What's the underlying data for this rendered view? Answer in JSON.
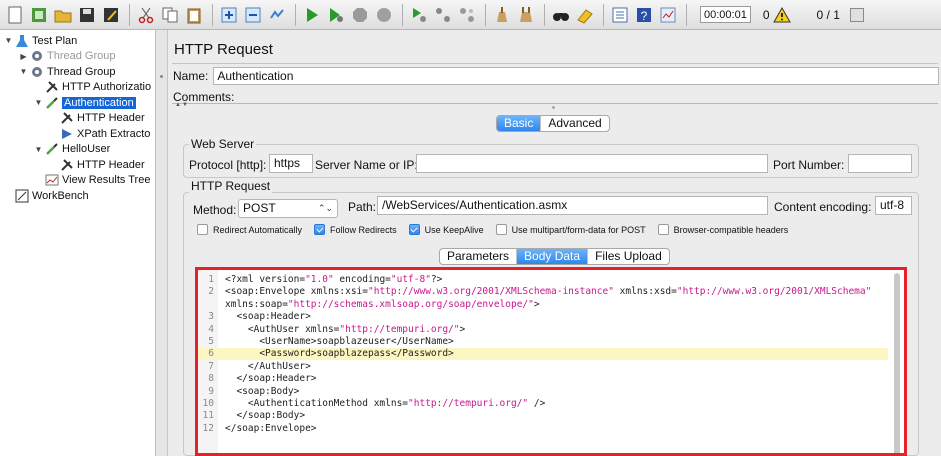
{
  "toolbar": {
    "icons": [
      "new-icon",
      "templates-icon",
      "open-icon",
      "save-icon",
      "save-as-icon",
      "cut-icon",
      "copy-icon",
      "paste-icon",
      "expand-icon",
      "collapse-icon",
      "toggle-icon",
      "start-icon",
      "start-no-timers-icon",
      "stop-icon",
      "shutdown-icon",
      "remote-start-icon",
      "remote-stop-icon",
      "remote-exit-icon",
      "clear-icon",
      "clear-all-icon",
      "search-icon",
      "reset-search-icon",
      "function-helper-icon",
      "help-icon",
      "log-viewer-icon"
    ],
    "timer": "00:00:01",
    "warning_count": "0",
    "threads": "0 / 1"
  },
  "tree": [
    {
      "label": "Test Plan",
      "level": 0,
      "expander": "down",
      "icon": "test-plan-icon",
      "selected": false,
      "disabled": false
    },
    {
      "label": "Thread Group",
      "level": 1,
      "expander": "right",
      "icon": "gear-icon",
      "selected": false,
      "disabled": true
    },
    {
      "label": "Thread Group",
      "level": 1,
      "expander": "down",
      "icon": "gear-icon",
      "selected": false,
      "disabled": false
    },
    {
      "label": "HTTP Authorizatio",
      "level": 2,
      "expander": "",
      "icon": "wrench-icon",
      "selected": false,
      "disabled": false
    },
    {
      "label": "Authentication",
      "level": 2,
      "expander": "down",
      "icon": "pipette-icon",
      "selected": true,
      "disabled": false
    },
    {
      "label": "HTTP Header",
      "level": 3,
      "expander": "",
      "icon": "wrench-icon",
      "selected": false,
      "disabled": false
    },
    {
      "label": "XPath Extracto",
      "level": 3,
      "expander": "",
      "icon": "extractor-icon",
      "selected": false,
      "disabled": false
    },
    {
      "label": "HelloUser",
      "level": 2,
      "expander": "down",
      "icon": "pipette-icon",
      "selected": false,
      "disabled": false
    },
    {
      "label": "HTTP Header",
      "level": 3,
      "expander": "",
      "icon": "wrench-icon",
      "selected": false,
      "disabled": false
    },
    {
      "label": "View Results Tree",
      "level": 2,
      "expander": "",
      "icon": "chart-icon",
      "selected": false,
      "disabled": false
    },
    {
      "label": "WorkBench",
      "level": 0,
      "expander": "",
      "icon": "workbench-icon",
      "selected": false,
      "disabled": false
    }
  ],
  "panel": {
    "title": "HTTP Request",
    "name_label": "Name:",
    "name_value": "Authentication",
    "comments_label": "Comments:",
    "tabs_top": [
      "Basic",
      "Advanced"
    ],
    "web_server": {
      "title": "Web Server",
      "protocol_label": "Protocol [http]:",
      "protocol_value": "https",
      "server_label": "Server Name or IP:",
      "server_value": "",
      "port_label": "Port Number:",
      "port_value": ""
    },
    "http_request": {
      "title": "HTTP Request",
      "method_label": "Method:",
      "method_value": "POST",
      "path_label": "Path:",
      "path_value": "/WebServices/Authentication.asmx",
      "encoding_label": "Content encoding:",
      "encoding_value": "utf-8"
    },
    "checkboxes": [
      {
        "label": "Redirect Automatically",
        "checked": false
      },
      {
        "label": "Follow Redirects",
        "checked": true
      },
      {
        "label": "Use KeepAlive",
        "checked": true
      },
      {
        "label": "Use multipart/form-data for POST",
        "checked": false
      },
      {
        "label": "Browser-compatible headers",
        "checked": false
      }
    ],
    "tabs_body": [
      "Parameters",
      "Body Data",
      "Files Upload"
    ],
    "body_lines": [
      "<?xml version=\"1.0\" encoding=\"utf-8\"?>",
      "<soap:Envelope xmlns:xsi=\"http://www.w3.org/2001/XMLSchema-instance\" xmlns:xsd=\"http://www.w3.org/2001/XMLSchema\"",
      "xmlns:soap=\"http://schemas.xmlsoap.org/soap/envelope/\">",
      "  <soap:Header>",
      "    <AuthUser xmlns=\"http://tempuri.org/\">",
      "      <UserName>soapblazeuser</UserName>",
      "      <Password>soapblazepass</Password>",
      "    </AuthUser>",
      "  </soap:Header>",
      "  <soap:Body>",
      "    <AuthenticationMethod xmlns=\"http://tempuri.org/\" />",
      "  </soap:Body>",
      "</soap:Envelope>"
    ],
    "body_line_numbers": [
      "1",
      "2",
      "",
      "3",
      "4",
      "5",
      "6",
      "7",
      "8",
      "9",
      "10",
      "11",
      "12"
    ]
  }
}
